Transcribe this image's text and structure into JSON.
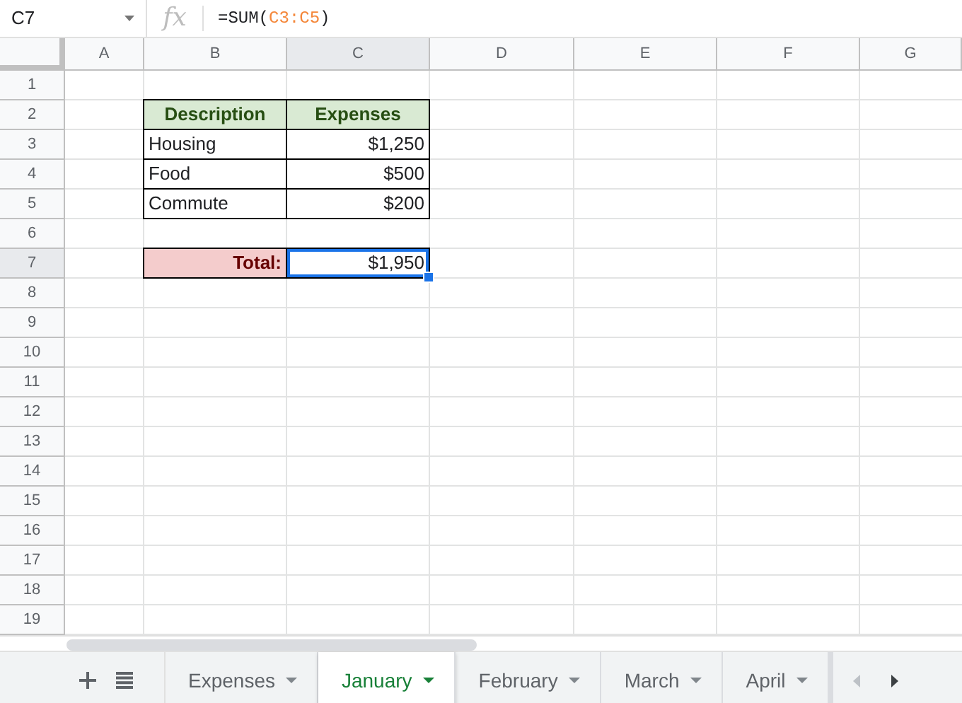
{
  "formula_bar": {
    "name_box": "C7",
    "fx_label": "fx",
    "formula": [
      {
        "text": "=SUM(",
        "color": "#202124"
      },
      {
        "text": "C3:C5",
        "color": "#f4873a"
      },
      {
        "text": ")",
        "color": "#202124"
      }
    ]
  },
  "columns": [
    {
      "label": "A",
      "selected": false
    },
    {
      "label": "B",
      "selected": false
    },
    {
      "label": "C",
      "selected": true
    },
    {
      "label": "D",
      "selected": false
    },
    {
      "label": "E",
      "selected": false
    },
    {
      "label": "F",
      "selected": false
    },
    {
      "label": "G",
      "selected": false
    }
  ],
  "rows": [
    {
      "label": "1",
      "selected": false
    },
    {
      "label": "2",
      "selected": false
    },
    {
      "label": "3",
      "selected": false
    },
    {
      "label": "4",
      "selected": false
    },
    {
      "label": "5",
      "selected": false
    },
    {
      "label": "6",
      "selected": false
    },
    {
      "label": "7",
      "selected": true
    },
    {
      "label": "8",
      "selected": false
    },
    {
      "label": "9",
      "selected": false
    },
    {
      "label": "10",
      "selected": false
    },
    {
      "label": "11",
      "selected": false
    },
    {
      "label": "12",
      "selected": false
    },
    {
      "label": "13",
      "selected": false
    },
    {
      "label": "14",
      "selected": false
    },
    {
      "label": "15",
      "selected": false
    },
    {
      "label": "16",
      "selected": false
    },
    {
      "label": "17",
      "selected": false
    },
    {
      "label": "18",
      "selected": false
    },
    {
      "label": "19",
      "selected": false
    }
  ],
  "expense_table": {
    "header": [
      {
        "text": "Description",
        "selected": false
      },
      {
        "text": "Expenses",
        "selected": false
      }
    ],
    "rows": [
      [
        {
          "text": "Housing",
          "selected": false
        },
        {
          "text": "$1,250",
          "selected": false
        }
      ],
      [
        {
          "text": "Food",
          "selected": false
        },
        {
          "text": "$500",
          "selected": false
        }
      ],
      [
        {
          "text": "Commute",
          "selected": false
        },
        {
          "text": "$200",
          "selected": false
        }
      ]
    ]
  },
  "total_row": [
    {
      "text": "Total:",
      "selected": false
    },
    {
      "text": "$1,950",
      "selected": true
    }
  ],
  "sheet_tabs": [
    {
      "label": "Expenses",
      "selected": false
    },
    {
      "label": "January",
      "selected": true
    },
    {
      "label": "February",
      "selected": false
    },
    {
      "label": "March",
      "selected": false
    },
    {
      "label": "April",
      "selected": false
    }
  ]
}
